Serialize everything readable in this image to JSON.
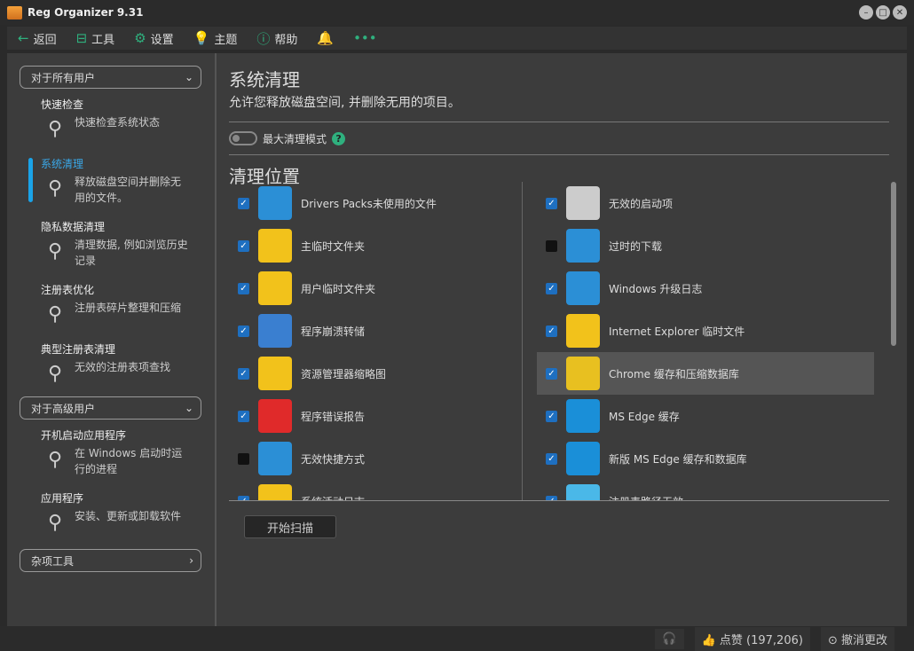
{
  "window": {
    "title": "Reg Organizer 9.31"
  },
  "toolbar": {
    "back": "返回",
    "tools": "工具",
    "settings": "设置",
    "theme": "主题",
    "help": "帮助",
    "more": "•••"
  },
  "sidebar": {
    "group_all": "对于所有用户",
    "group_adv": "对于高级用户",
    "group_misc": "杂项工具",
    "items": [
      {
        "title": "快速检查",
        "desc": "快速检查系统状态",
        "icon": "magnifier-check-icon"
      },
      {
        "title": "系统清理",
        "desc": "释放磁盘空间并删除无用的文件。",
        "icon": "broom-icon",
        "active": true
      },
      {
        "title": "隐私数据清理",
        "desc": "清理数据, 例如浏览历史记录",
        "icon": "footprints-icon"
      },
      {
        "title": "注册表优化",
        "desc": "注册表碎片整理和压缩",
        "icon": "registry-icon"
      },
      {
        "title": "典型注册表清理",
        "desc": "无效的注册表项查找",
        "icon": "broom-icon"
      }
    ],
    "adv_items": [
      {
        "title": "开机启动应用程序",
        "desc": "在 Windows 启动时运行的进程",
        "icon": "startup-icon"
      },
      {
        "title": "应用程序",
        "desc": "安装、更新或卸载软件",
        "icon": "box-trash-icon"
      }
    ]
  },
  "content": {
    "title": "系统清理",
    "subtitle": "允许您释放磁盘空间, 并删除无用的项目。",
    "max_mode": "最大清理模式",
    "section": "清理位置",
    "scan_button": "开始扫描",
    "left": [
      {
        "label": "Drivers Packs未使用的文件",
        "checked": true,
        "color": "#2b8fd6"
      },
      {
        "label": "主临时文件夹",
        "checked": true,
        "color": "#f2c21b"
      },
      {
        "label": "用户临时文件夹",
        "checked": true,
        "color": "#f2c21b"
      },
      {
        "label": "程序崩溃转储",
        "checked": true,
        "color": "#3a7fd0"
      },
      {
        "label": "资源管理器缩略图",
        "checked": true,
        "color": "#f2c21b"
      },
      {
        "label": "程序错误报告",
        "checked": true,
        "color": "#e02a2a"
      },
      {
        "label": "无效快捷方式",
        "checked": false,
        "color": "#2b8fd6"
      },
      {
        "label": "系统活动日志",
        "checked": true,
        "color": "#f2c21b"
      }
    ],
    "right": [
      {
        "label": "无效的启动项",
        "checked": true,
        "color": "#cccccc"
      },
      {
        "label": "过时的下载",
        "checked": false,
        "color": "#2b8fd6"
      },
      {
        "label": "Windows 升级日志",
        "checked": true,
        "color": "#2b8fd6"
      },
      {
        "label": "Internet Explorer 临时文件",
        "checked": true,
        "color": "#f2c21b"
      },
      {
        "label": "Chrome 缓存和压缩数据库",
        "checked": true,
        "color": "#e8c020",
        "highlight": true
      },
      {
        "label": "MS Edge 缓存",
        "checked": true,
        "color": "#1a8fd8"
      },
      {
        "label": "新版 MS Edge 缓存和数据库",
        "checked": true,
        "color": "#1a8fd8"
      },
      {
        "label": "注册表路径无效",
        "checked": true,
        "color": "#4ab8e8"
      }
    ]
  },
  "status": {
    "likes": "点赞 (197,206)",
    "undo": "撤消更改"
  },
  "colors": {
    "accent": "#2fb07e",
    "active": "#1aa3e8",
    "checkbox": "#1e6fc0"
  }
}
